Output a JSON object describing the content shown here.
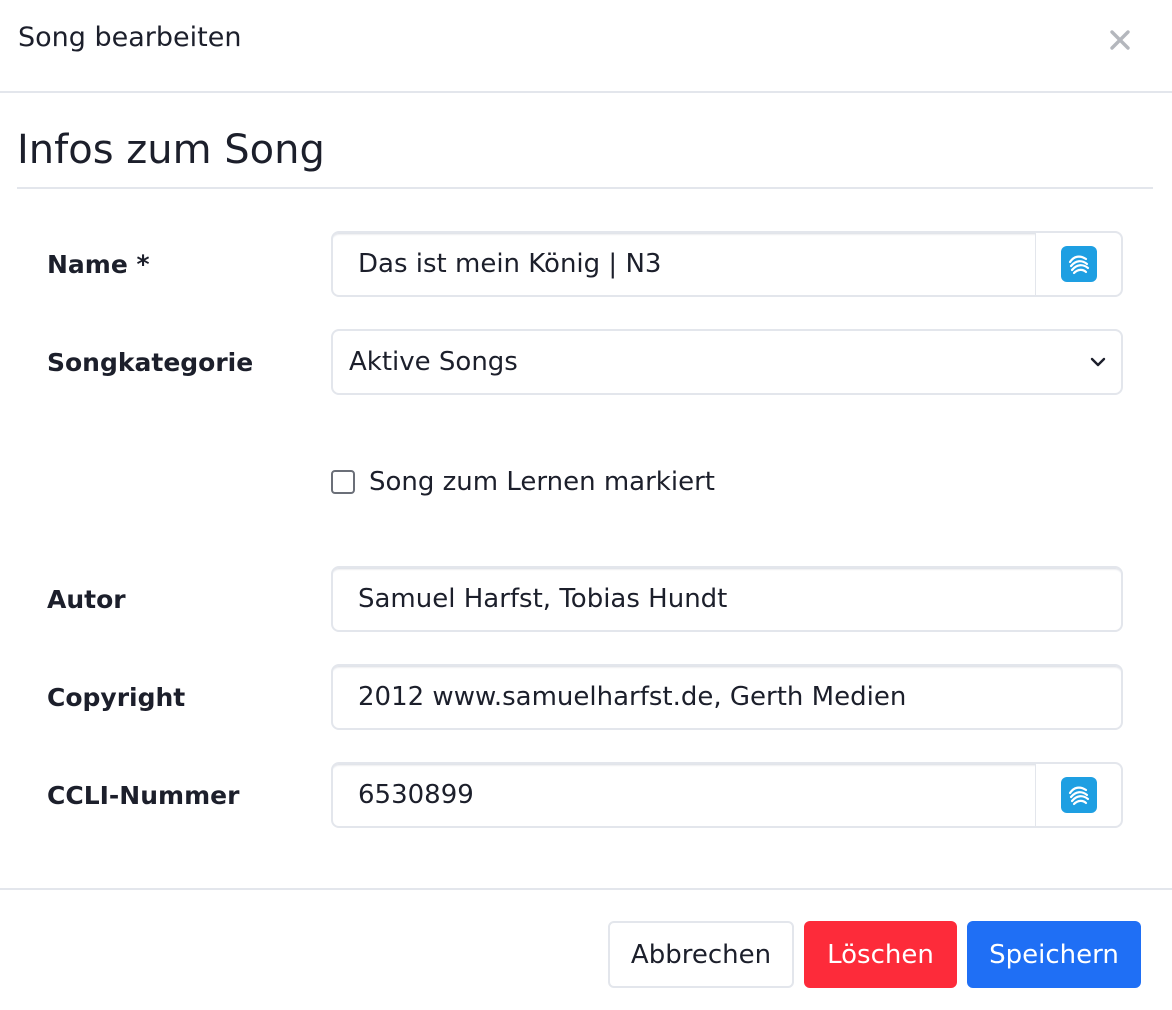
{
  "modal": {
    "title": "Song bearbeiten",
    "close_symbol": "×"
  },
  "section": {
    "title": "Infos zum Song"
  },
  "form": {
    "name": {
      "label": "Name *",
      "value": "Das ist mein König | N3"
    },
    "category": {
      "label": "Songkategorie",
      "value": "Aktive Songs"
    },
    "learn_checkbox": {
      "label": "Song zum Lernen markiert",
      "checked": false
    },
    "author": {
      "label": "Autor",
      "value": "Samuel Harfst, Tobias Hundt"
    },
    "copyright": {
      "label": "Copyright",
      "value": "2012 www.samuelharfst.de, Gerth Medien"
    },
    "ccli": {
      "label": "CCLI-Nummer",
      "value": "6530899"
    }
  },
  "addon_icon": {
    "name": "songselect-icon",
    "color": "#1e9fe2"
  },
  "buttons": {
    "cancel": "Abbrechen",
    "delete": "Löschen",
    "save": "Speichern"
  },
  "colors": {
    "delete": "#fd2b3a",
    "save": "#1f6ff5"
  }
}
